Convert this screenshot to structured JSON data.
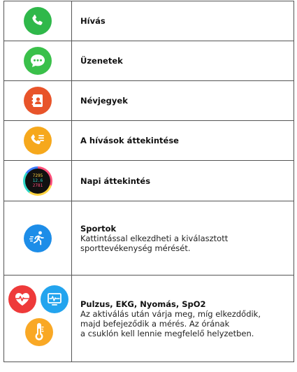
{
  "rows": [
    {
      "icon": "phone-icon",
      "title": "Hívás"
    },
    {
      "icon": "message-icon",
      "title": "Üzenetek"
    },
    {
      "icon": "contacts-icon",
      "title": "Névjegyek"
    },
    {
      "icon": "call-log-icon",
      "title": "A hívások áttekintése"
    },
    {
      "icon": "watchface-icon",
      "title": "Napi áttekintés"
    },
    {
      "icon": "running-icon",
      "title": "Sportok",
      "desc": [
        "Kattintással elkezdheti a kiválasztott",
        "sporttevékenység mérését."
      ]
    },
    {
      "icons": [
        "heart-rate-icon",
        "ecg-icon",
        "spo2-icon"
      ],
      "title": "Pulzus, EKG, Nyomás, SpO2",
      "desc": [
        "Az aktiválás után várja meg, míg elkezdődik,",
        "majd befejeződik a mérés. Az órának",
        "a csuklón kell lennie megfelelő helyzetben."
      ]
    }
  ],
  "watchface_text": {
    "line1": "7295",
    "line2": "12.6",
    "line3": "2781"
  }
}
